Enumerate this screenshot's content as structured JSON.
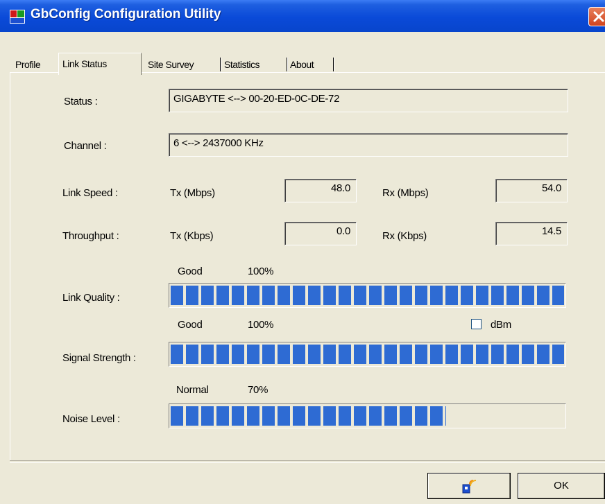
{
  "window": {
    "title": "GbConfig Configuration Utility"
  },
  "tabs": [
    {
      "label": "Profile"
    },
    {
      "label": "Link Status"
    },
    {
      "label": "Site Survey"
    },
    {
      "label": "Statistics"
    },
    {
      "label": "About"
    }
  ],
  "active_tab": "Link Status",
  "status": {
    "label": "Status :",
    "value": "GIGABYTE <--> 00-20-ED-0C-DE-72"
  },
  "channel": {
    "label": "Channel :",
    "value": "6 <--> 2437000 KHz"
  },
  "link_speed": {
    "label": "Link Speed :",
    "tx_label": "Tx (Mbps)",
    "tx_value": "48.0",
    "rx_label": "Rx (Mbps)",
    "rx_value": "54.0"
  },
  "throughput": {
    "label": "Throughput :",
    "tx_label": "Tx (Kbps)",
    "tx_value": "0.0",
    "rx_label": "Rx (Kbps)",
    "rx_value": "14.5"
  },
  "link_quality": {
    "label": "Link Quality :",
    "rating": "Good",
    "percent_text": "100%",
    "percent": 100
  },
  "signal_strength": {
    "label": "Signal Strength :",
    "rating": "Good",
    "percent_text": "100%",
    "percent": 100,
    "dbm_label": "dBm",
    "dbm_checked": false
  },
  "noise_level": {
    "label": "Noise Level :",
    "rating": "Normal",
    "percent_text": "70%",
    "percent": 70
  },
  "buttons": {
    "ok_label": "OK"
  },
  "colors": {
    "bar": "#2e6bd3",
    "title_bar": "#0a4ad8",
    "window_bg": "#ece9d8"
  },
  "icons": {
    "app": "app-logo-icon",
    "close": "close-icon",
    "radio": "wireless-radio-icon"
  }
}
